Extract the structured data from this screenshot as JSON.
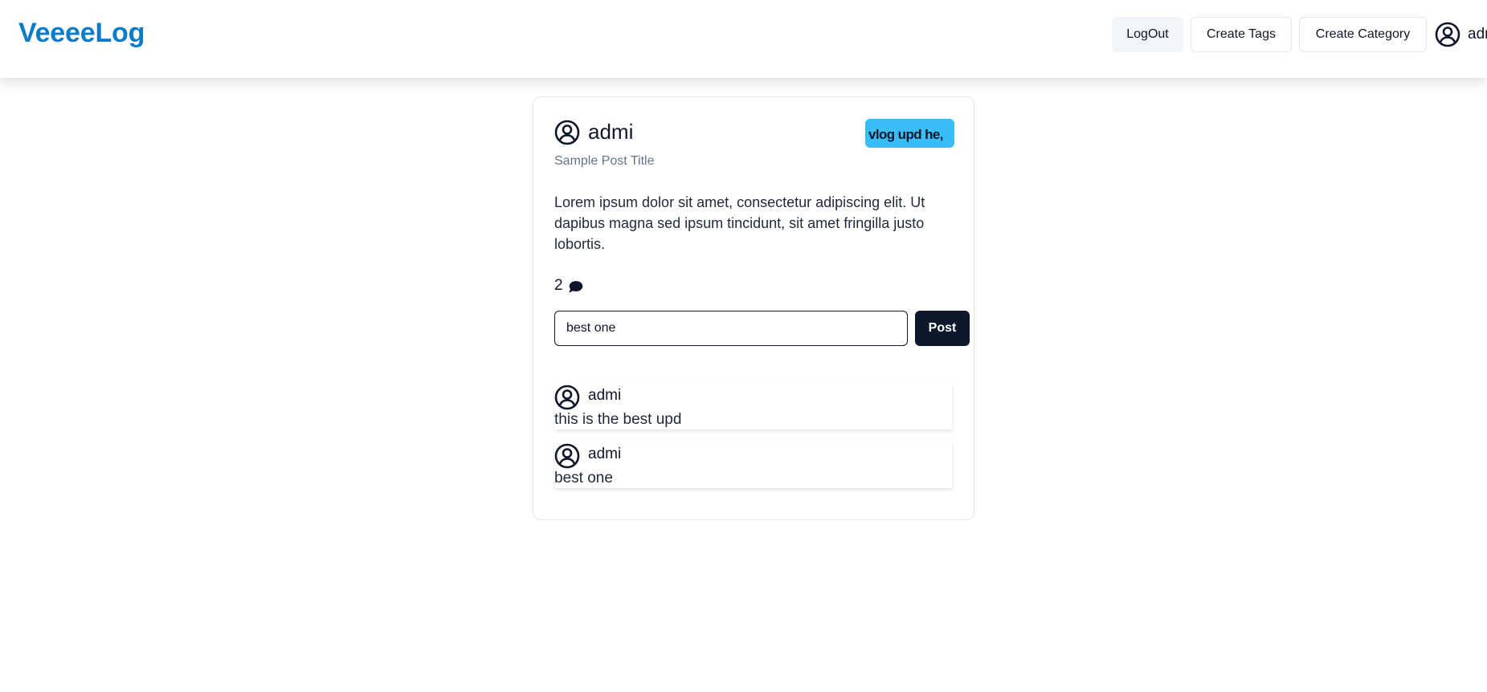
{
  "app": {
    "brand": "VeeeeLog"
  },
  "nav": {
    "logout_label": "LogOut",
    "create_tags_label": "Create Tags",
    "create_category_label": "Create Category",
    "user_name": "admi",
    "user_icon": "user-circle-icon"
  },
  "post": {
    "author": "admi",
    "author_icon": "user-circle-icon",
    "tag": "vlog upd he,",
    "title": "Sample Post Title",
    "body": "Lorem ipsum dolor sit amet, consectetur adipiscing elit. Ut dapibus magna sed ipsum tincidunt, sit amet fringilla justo lobortis.",
    "comment_count": "2",
    "comment_count_icon": "chat-bubble-icon"
  },
  "comment_form": {
    "input_value": "best one",
    "submit_label": "Post"
  },
  "comments": [
    {
      "author": "admi",
      "text": "this is the best upd"
    },
    {
      "author": "admi",
      "text": "best one"
    }
  ],
  "colors": {
    "brand": "#0b7cc7",
    "tag_badge": "#38bdf8",
    "primary_button": "#0f172a",
    "muted_text": "#64748b"
  }
}
